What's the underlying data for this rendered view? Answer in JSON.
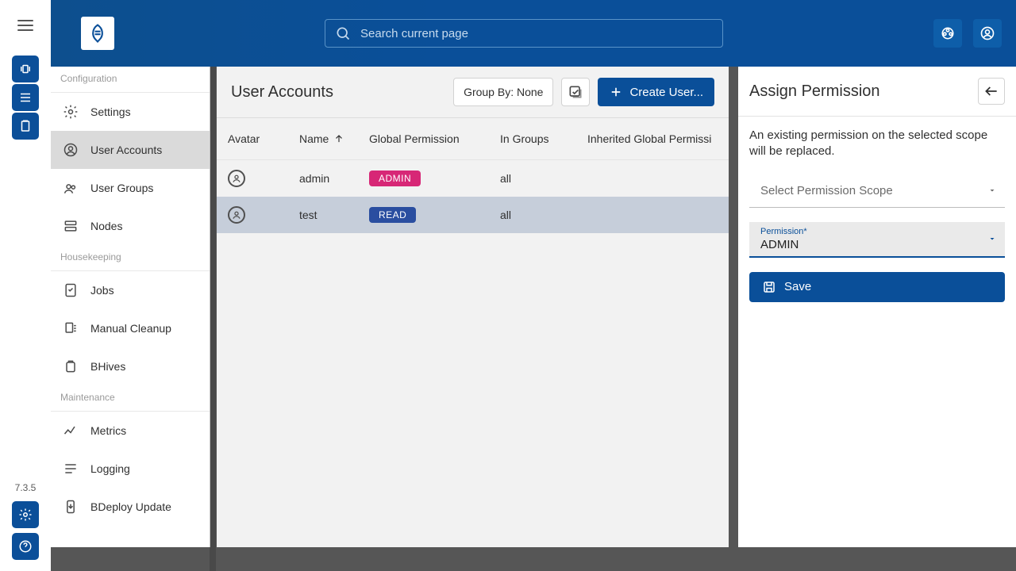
{
  "rail": {
    "version": "7.3.5"
  },
  "topbar": {
    "search_placeholder": "Search current page"
  },
  "sidebar": {
    "sections": {
      "configuration": {
        "title": "Configuration"
      },
      "housekeeping": {
        "title": "Housekeeping"
      },
      "maintenance": {
        "title": "Maintenance"
      }
    },
    "items": {
      "settings": {
        "label": "Settings"
      },
      "user_accounts": {
        "label": "User Accounts"
      },
      "user_groups": {
        "label": "User Groups"
      },
      "nodes": {
        "label": "Nodes"
      },
      "jobs": {
        "label": "Jobs"
      },
      "manual_cleanup": {
        "label": "Manual Cleanup"
      },
      "bhives": {
        "label": "BHives"
      },
      "metrics": {
        "label": "Metrics"
      },
      "logging": {
        "label": "Logging"
      },
      "bdeploy_update": {
        "label": "BDeploy Update"
      }
    }
  },
  "main": {
    "title": "User Accounts",
    "group_by_label": "Group By: None",
    "create_user_label": "Create User...",
    "columns": {
      "avatar": "Avatar",
      "name": "Name",
      "global_permission": "Global Permission",
      "in_groups": "In Groups",
      "inherited_global_permission": "Inherited Global Permissi"
    },
    "rows": [
      {
        "name": "admin",
        "permission": "ADMIN",
        "permission_color": "admin",
        "groups": "all"
      },
      {
        "name": "test",
        "permission": "READ",
        "permission_color": "read",
        "groups": "all"
      }
    ]
  },
  "inspector": {
    "title": "Assign Permission",
    "desc": "An existing permission on the selected scope will be replaced.",
    "scope_placeholder": "Select Permission Scope",
    "permission_label": "Permission*",
    "permission_value": "ADMIN",
    "save_label": "Save"
  }
}
